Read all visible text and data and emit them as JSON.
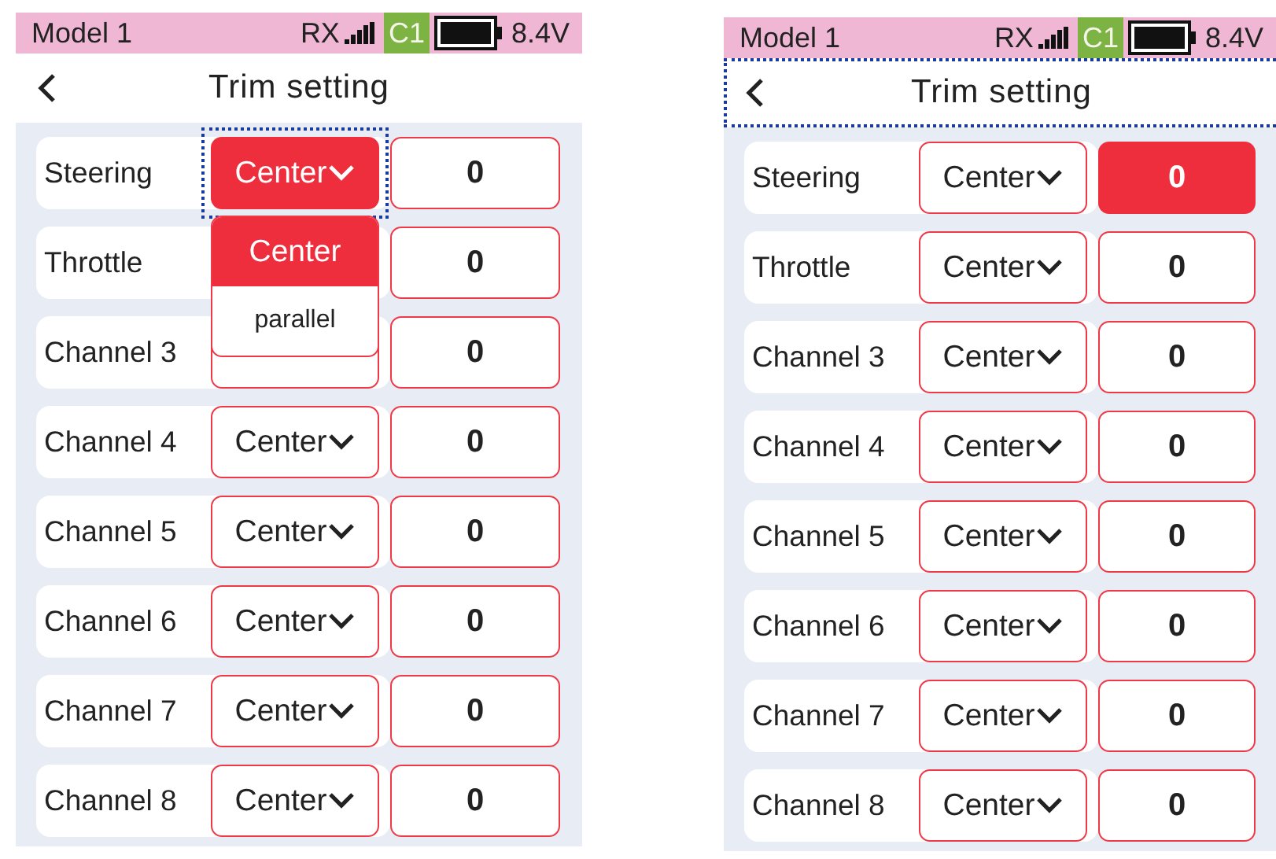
{
  "screens": [
    {
      "status": {
        "model": "Model 1",
        "rx": "RX",
        "channel": "C1",
        "voltage": "8.4V"
      },
      "header": {
        "title": "Trim setting",
        "focused": false
      },
      "rows": [
        {
          "label": "Steering",
          "mode": "Center",
          "value": "0",
          "mode_selected": true,
          "mode_focused": true,
          "value_selected": false,
          "dropdown": [
            {
              "label": "Center",
              "selected": true
            },
            {
              "label": "parallel",
              "selected": false
            }
          ]
        },
        {
          "label": "Throttle",
          "value": "0",
          "value_selected": false
        },
        {
          "label": "Channel 3",
          "value": "0",
          "value_selected": false
        },
        {
          "label": "Channel 4",
          "mode": "Center",
          "value": "0",
          "mode_selected": false,
          "mode_focused": false,
          "value_selected": false
        },
        {
          "label": "Channel 5",
          "mode": "Center",
          "value": "0",
          "mode_selected": false,
          "mode_focused": false,
          "value_selected": false
        },
        {
          "label": "Channel 6",
          "mode": "Center",
          "value": "0",
          "mode_selected": false,
          "mode_focused": false,
          "value_selected": false
        },
        {
          "label": "Channel 7",
          "mode": "Center",
          "value": "0",
          "mode_selected": false,
          "mode_focused": false,
          "value_selected": false
        },
        {
          "label": "Channel 8",
          "mode": "Center",
          "value": "0",
          "mode_selected": false,
          "mode_focused": false,
          "value_selected": false
        }
      ]
    },
    {
      "status": {
        "model": "Model 1",
        "rx": "RX",
        "channel": "C1",
        "voltage": "8.4V"
      },
      "header": {
        "title": "Trim setting",
        "focused": true
      },
      "rows": [
        {
          "label": "Steering",
          "mode": "Center",
          "value": "0",
          "mode_selected": false,
          "mode_focused": false,
          "value_selected": true
        },
        {
          "label": "Throttle",
          "mode": "Center",
          "value": "0",
          "mode_selected": false,
          "mode_focused": false,
          "value_selected": false
        },
        {
          "label": "Channel 3",
          "mode": "Center",
          "value": "0",
          "mode_selected": false,
          "mode_focused": false,
          "value_selected": false
        },
        {
          "label": "Channel 4",
          "mode": "Center",
          "value": "0",
          "mode_selected": false,
          "mode_focused": false,
          "value_selected": false
        },
        {
          "label": "Channel 5",
          "mode": "Center",
          "value": "0",
          "mode_selected": false,
          "mode_focused": false,
          "value_selected": false
        },
        {
          "label": "Channel 6",
          "mode": "Center",
          "value": "0",
          "mode_selected": false,
          "mode_focused": false,
          "value_selected": false
        },
        {
          "label": "Channel 7",
          "mode": "Center",
          "value": "0",
          "mode_selected": false,
          "mode_focused": false,
          "value_selected": false
        },
        {
          "label": "Channel 8",
          "mode": "Center",
          "value": "0",
          "mode_selected": false,
          "mode_focused": false,
          "value_selected": false
        }
      ]
    }
  ]
}
